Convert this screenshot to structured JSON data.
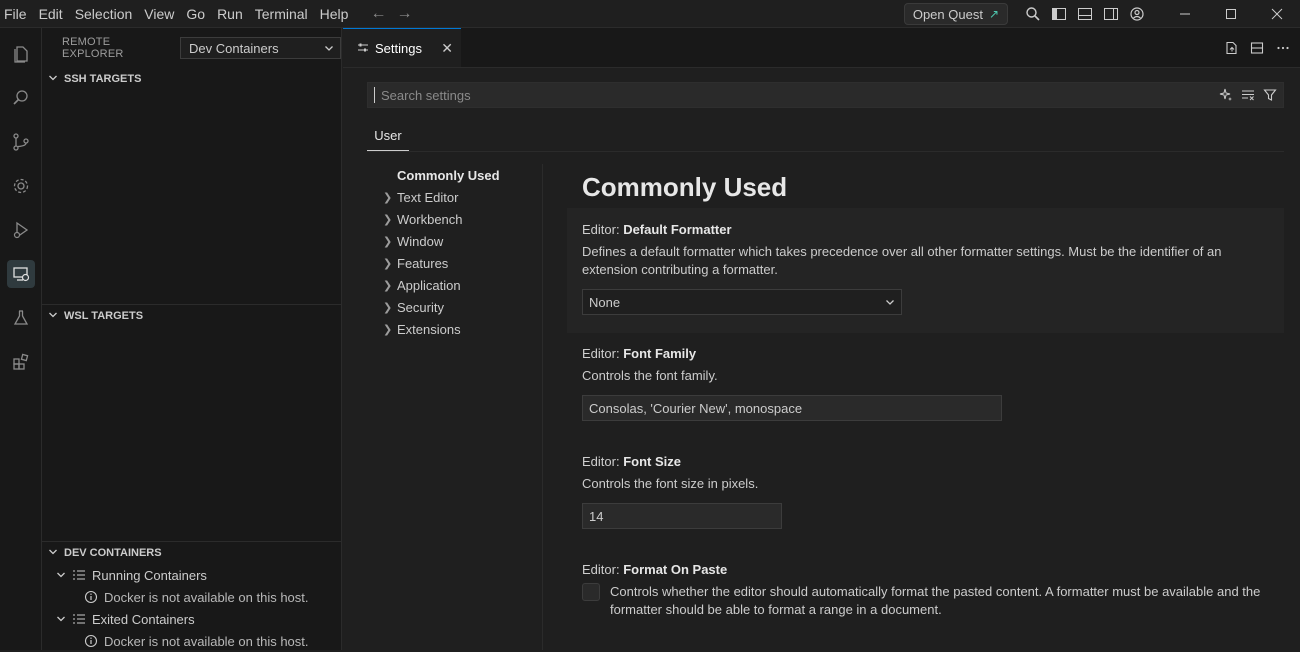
{
  "menu": [
    "File",
    "Edit",
    "Selection",
    "View",
    "Go",
    "Run",
    "Terminal",
    "Help"
  ],
  "titlebar": {
    "quest_label": "Open Quest"
  },
  "sidebar": {
    "title": "REMOTE EXPLORER",
    "select_value": "Dev Containers",
    "ssh_section": "SSH TARGETS",
    "wsl_section": "WSL TARGETS",
    "dev_section": "DEV CONTAINERS",
    "running": "Running Containers",
    "running_info": "Docker is not available on this host.",
    "exited": "Exited Containers",
    "exited_info": "Docker is not available on this host."
  },
  "editor": {
    "tab_label": "Settings",
    "search_placeholder": "Search settings",
    "scope_tab": "User",
    "toc": [
      "Commonly Used",
      "Text Editor",
      "Workbench",
      "Window",
      "Features",
      "Application",
      "Security",
      "Extensions"
    ],
    "content_title": "Commonly Used",
    "settings": [
      {
        "category": "Editor: ",
        "name": "Default Formatter",
        "desc": "Defines a default formatter which takes precedence over all other formatter settings. Must be the identifier of an extension contributing a formatter.",
        "value": "None"
      },
      {
        "category": "Editor: ",
        "name": "Font Family",
        "desc": "Controls the font family.",
        "value": "Consolas, 'Courier New', monospace"
      },
      {
        "category": "Editor: ",
        "name": "Font Size",
        "desc": "Controls the font size in pixels.",
        "value": "14"
      },
      {
        "category": "Editor: ",
        "name": "Format On Paste",
        "desc": "Controls whether the editor should automatically format the pasted content. A formatter must be available and the formatter should be able to format a range in a document."
      }
    ]
  },
  "colors": {
    "accent": "#0078d4",
    "background": "#1f1f1f",
    "sidebar": "#181818"
  }
}
